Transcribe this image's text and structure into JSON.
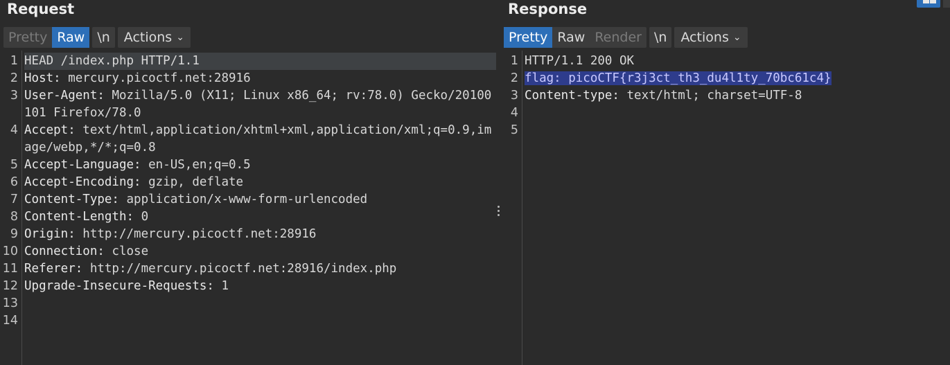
{
  "request": {
    "title": "Request",
    "tabs": [
      "Pretty",
      "Raw",
      "\\n"
    ],
    "actions_label": "Actions",
    "lines": [
      {
        "n": "1",
        "key": "",
        "text": "HEAD /index.php HTTP/1.1"
      },
      {
        "n": "2",
        "key": "Host: ",
        "text": "mercury.picoctf.net:28916"
      },
      {
        "n": "3",
        "key": "User-Agent: ",
        "text": "Mozilla/5.0 (X11; Linux x86_64; rv:78.0) Gecko/20100101 Firefox/78.0"
      },
      {
        "n": "4",
        "key": "Accept: ",
        "text": "text/html,application/xhtml+xml,application/xml;q=0.9,image/webp,*/*;q=0.8"
      },
      {
        "n": "5",
        "key": "Accept-Language: ",
        "text": "en-US,en;q=0.5"
      },
      {
        "n": "6",
        "key": "Accept-Encoding: ",
        "text": "gzip, deflate"
      },
      {
        "n": "7",
        "key": "Content-Type: ",
        "text": "application/x-www-form-urlencoded"
      },
      {
        "n": "8",
        "key": "Content-Length: ",
        "text": "0"
      },
      {
        "n": "9",
        "key": "Origin: ",
        "text": "http://mercury.picoctf.net:28916"
      },
      {
        "n": "10",
        "key": "Connection: ",
        "text": "close"
      },
      {
        "n": "11",
        "key": "Referer: ",
        "text": "http://mercury.picoctf.net:28916/index.php"
      },
      {
        "n": "12",
        "key": "Upgrade-Insecure-Requests: ",
        "text": "1"
      },
      {
        "n": "13",
        "key": "",
        "text": ""
      },
      {
        "n": "14",
        "key": "",
        "text": ""
      }
    ]
  },
  "response": {
    "title": "Response",
    "tabs": [
      "Pretty",
      "Raw",
      "Render",
      "\\n"
    ],
    "actions_label": "Actions",
    "lines": [
      {
        "n": "1",
        "key": "",
        "text": "HTTP/1.1 200 OK"
      },
      {
        "n": "2",
        "key": "flag: ",
        "text": "picoCTF{r3j3ct_th3_du4l1ty_70bc61c4}"
      },
      {
        "n": "3",
        "key": "Content-type: ",
        "text": "text/html; charset=UTF-8"
      },
      {
        "n": "4",
        "key": "",
        "text": ""
      },
      {
        "n": "5",
        "key": "",
        "text": ""
      }
    ]
  }
}
